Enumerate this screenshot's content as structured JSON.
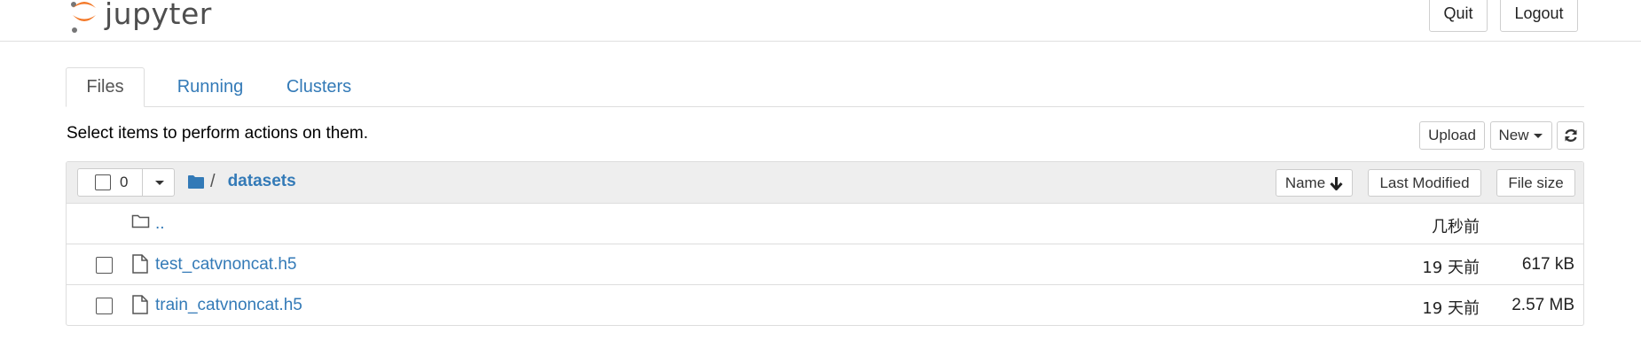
{
  "header": {
    "logo_text": "jupyter",
    "quit_label": "Quit",
    "logout_label": "Logout",
    "colors": {
      "logo_orange": "#f37726",
      "logo_gray": "#767677"
    }
  },
  "tabs": [
    {
      "label": "Files",
      "active": true
    },
    {
      "label": "Running",
      "active": false
    },
    {
      "label": "Clusters",
      "active": false
    }
  ],
  "toolbar": {
    "hint": "Select items to perform actions on them.",
    "upload_label": "Upload",
    "new_label": "New",
    "refresh_icon": "refresh-icon"
  },
  "list_header": {
    "selected_count": "0",
    "breadcrumb": {
      "root_icon": "folder-icon",
      "separator": "/",
      "current": "datasets"
    },
    "columns": {
      "name": "Name",
      "last_modified": "Last Modified",
      "file_size": "File size"
    },
    "sort_icon": "arrow-down-icon"
  },
  "rows": [
    {
      "type": "parent-folder",
      "icon": "folder-open-icon",
      "name": "..",
      "modified": "几秒前",
      "size": ""
    },
    {
      "type": "file",
      "icon": "file-icon",
      "name": "test_catvnoncat.h5",
      "modified": "19 天前",
      "size": "617 kB"
    },
    {
      "type": "file",
      "icon": "file-icon",
      "name": "train_catvnoncat.h5",
      "modified": "19 天前",
      "size": "2.57 MB"
    }
  ],
  "colors": {
    "link": "#337ab7",
    "header_bg": "#eeeeee",
    "border": "#dddddd"
  }
}
